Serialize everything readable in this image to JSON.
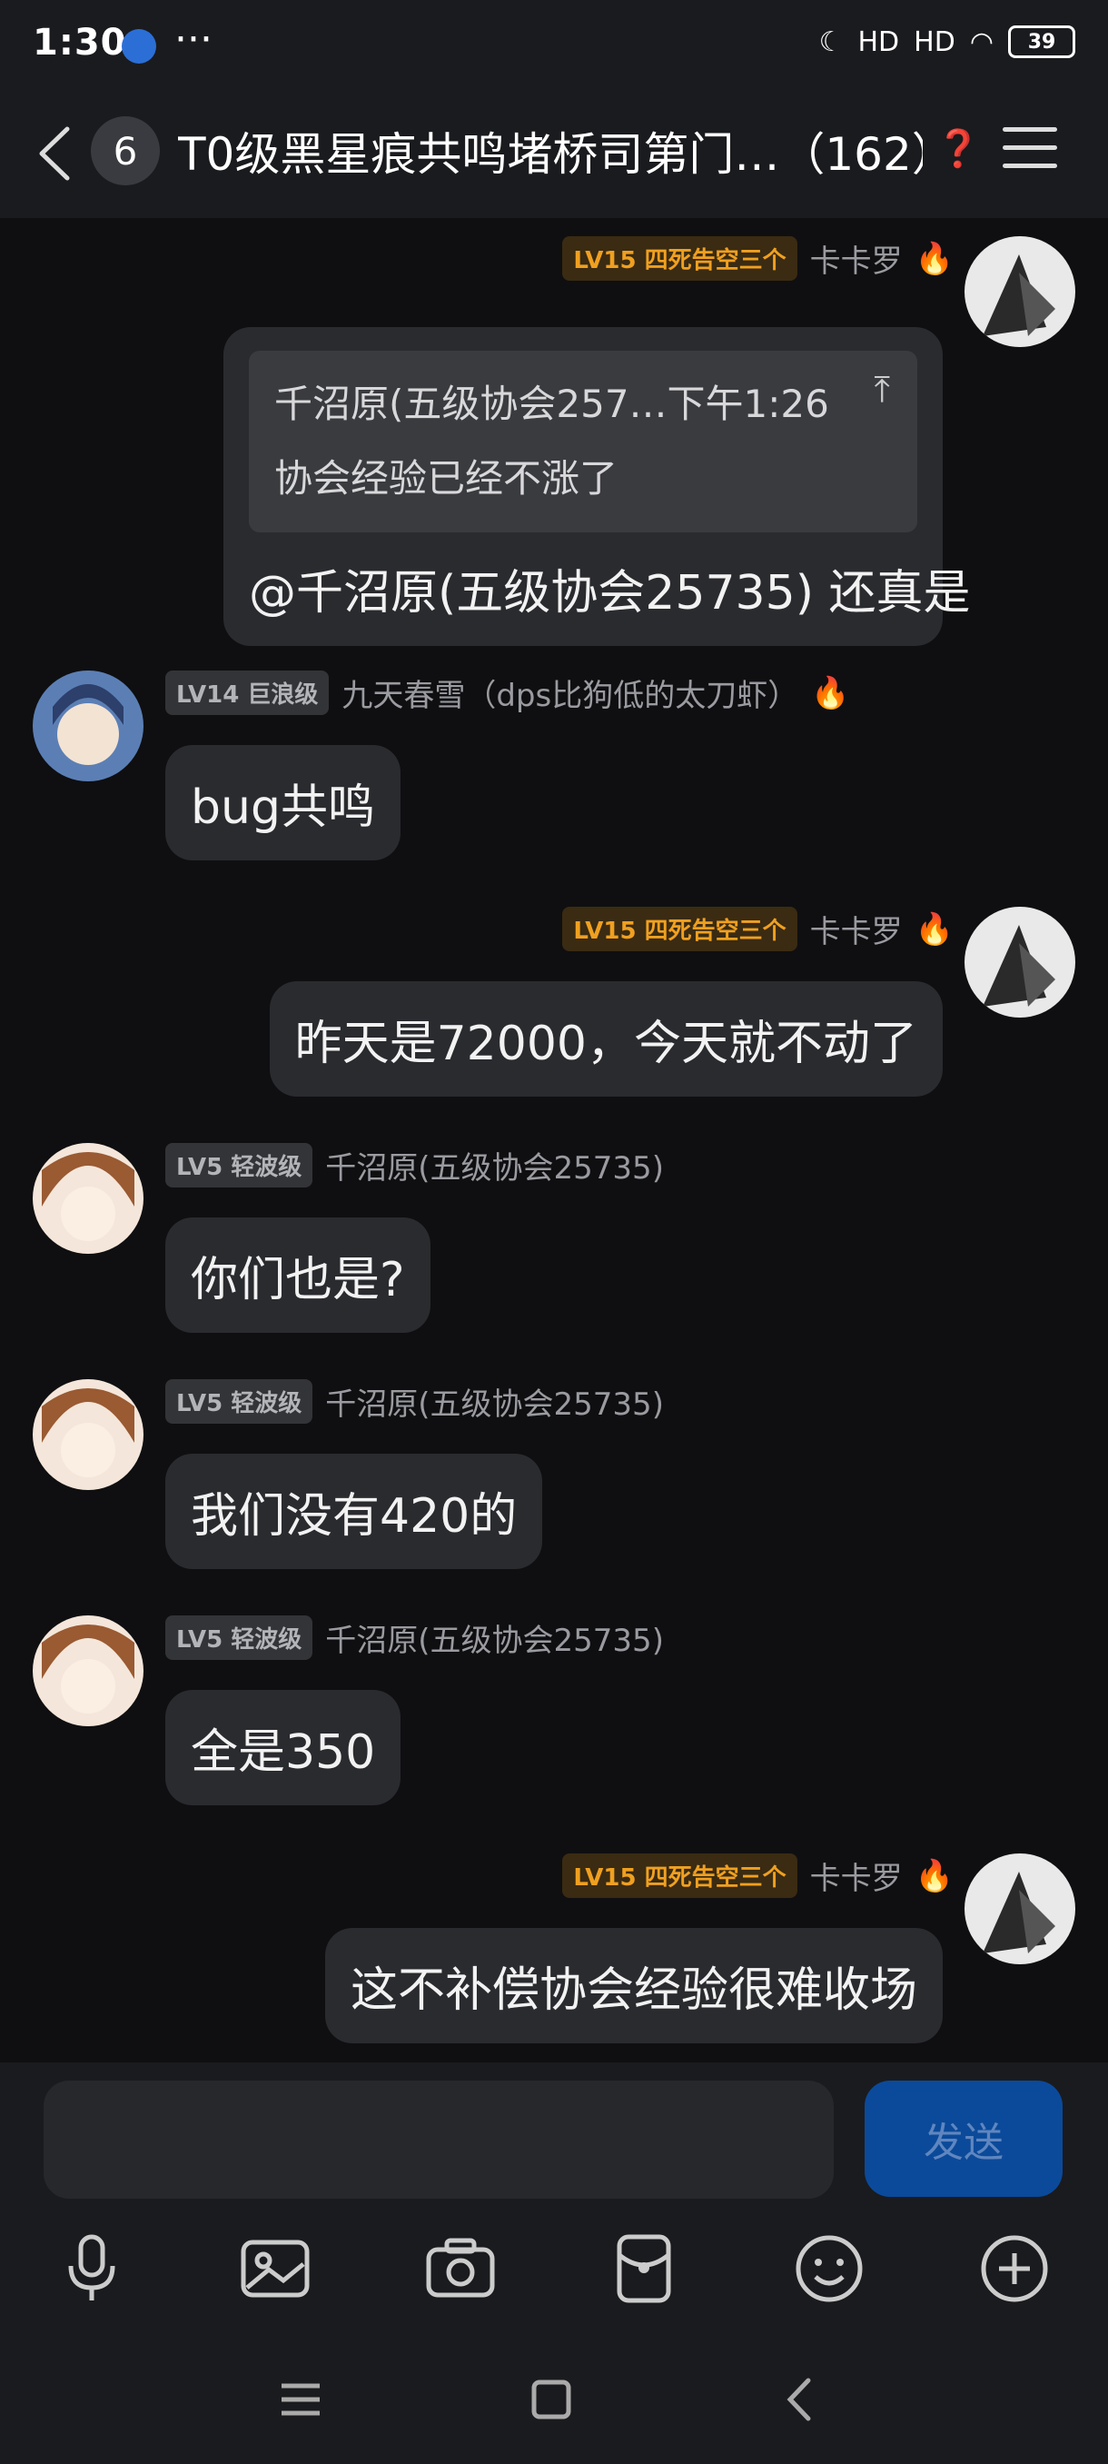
{
  "status_bar": {
    "time": "1:30",
    "more": "···",
    "battery": "39",
    "signal1": "HD",
    "signal2": "HD"
  },
  "header": {
    "unread_count": "6",
    "title": "T0级黑星痕共鸣堵桥司第门…（162）"
  },
  "messages": [
    {
      "side": "right",
      "level": "LV15 四死告空三个",
      "sender": "卡卡罗",
      "quote_header": "千沼原(五级协会257…下午1:26",
      "quote_text": "协会经验已经不涨了",
      "text": "@千沼原(五级协会25735) 还真是"
    },
    {
      "side": "left",
      "level": "LV14 巨浪级",
      "sender": "九天春雪（dps比狗低的太刀虾）",
      "text": "bug共鸣"
    },
    {
      "side": "right",
      "level": "LV15 四死告空三个",
      "sender": "卡卡罗",
      "text": "昨天是72000，今天就不动了"
    },
    {
      "side": "left",
      "level": "LV5 轻波级",
      "sender": "千沼原(五级协会25735)",
      "text": "你们也是?"
    },
    {
      "side": "left",
      "level": "LV5 轻波级",
      "sender": "千沼原(五级协会25735)",
      "text": "我们没有420的"
    },
    {
      "side": "left",
      "level": "LV5 轻波级",
      "sender": "千沼原(五级协会25735)",
      "text": "全是350"
    },
    {
      "side": "right",
      "level": "LV15 四死告空三个",
      "sender": "卡卡罗",
      "text": "这不补偿协会经验很难收场"
    }
  ],
  "input": {
    "placeholder": "",
    "send_label": "发送"
  },
  "colors": {
    "accent": "#0b4a9a",
    "level_gold": "#f0a020",
    "bubble": "#2a2b2f"
  }
}
